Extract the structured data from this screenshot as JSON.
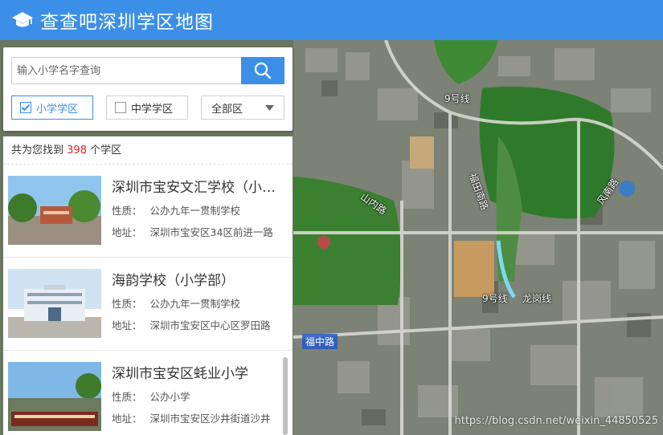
{
  "app": {
    "title": "查查吧深圳学区地图"
  },
  "search": {
    "placeholder": "输入小学名字查询"
  },
  "filters": {
    "primary_label": "小学学区",
    "middle_label": "中学学区",
    "district_label": "全部区"
  },
  "results": {
    "prefix": "共为您找到",
    "count": "398",
    "suffix": "个学区",
    "field_type": "性质：",
    "field_address": "地址：",
    "items": [
      {
        "name": "深圳市宝安文汇学校（小学部）",
        "type": "公办九年一贯制学校",
        "address": "深圳市宝安区34区前进一路"
      },
      {
        "name": "海韵学校（小学部）",
        "type": "公办九年一贯制学校",
        "address": "深圳市宝安区中心区罗田路"
      },
      {
        "name": "深圳市宝安区蚝业小学",
        "type": "公办小学",
        "address": "深圳市宝安区沙井街道沙井"
      }
    ]
  },
  "map": {
    "labels": {
      "line9_top": "9号线",
      "road1": "山内路",
      "road2": "福田南路",
      "road3": "风南路",
      "line9_bottom": "9号线",
      "line_longhua": "龙岗线",
      "fuzhong_road": "福中路"
    },
    "watermark": "https://blog.csdn.net/weixin_44850525"
  },
  "colors": {
    "header": "#3b8fe6",
    "accent": "#3b8fe6",
    "count": "#e02020"
  }
}
